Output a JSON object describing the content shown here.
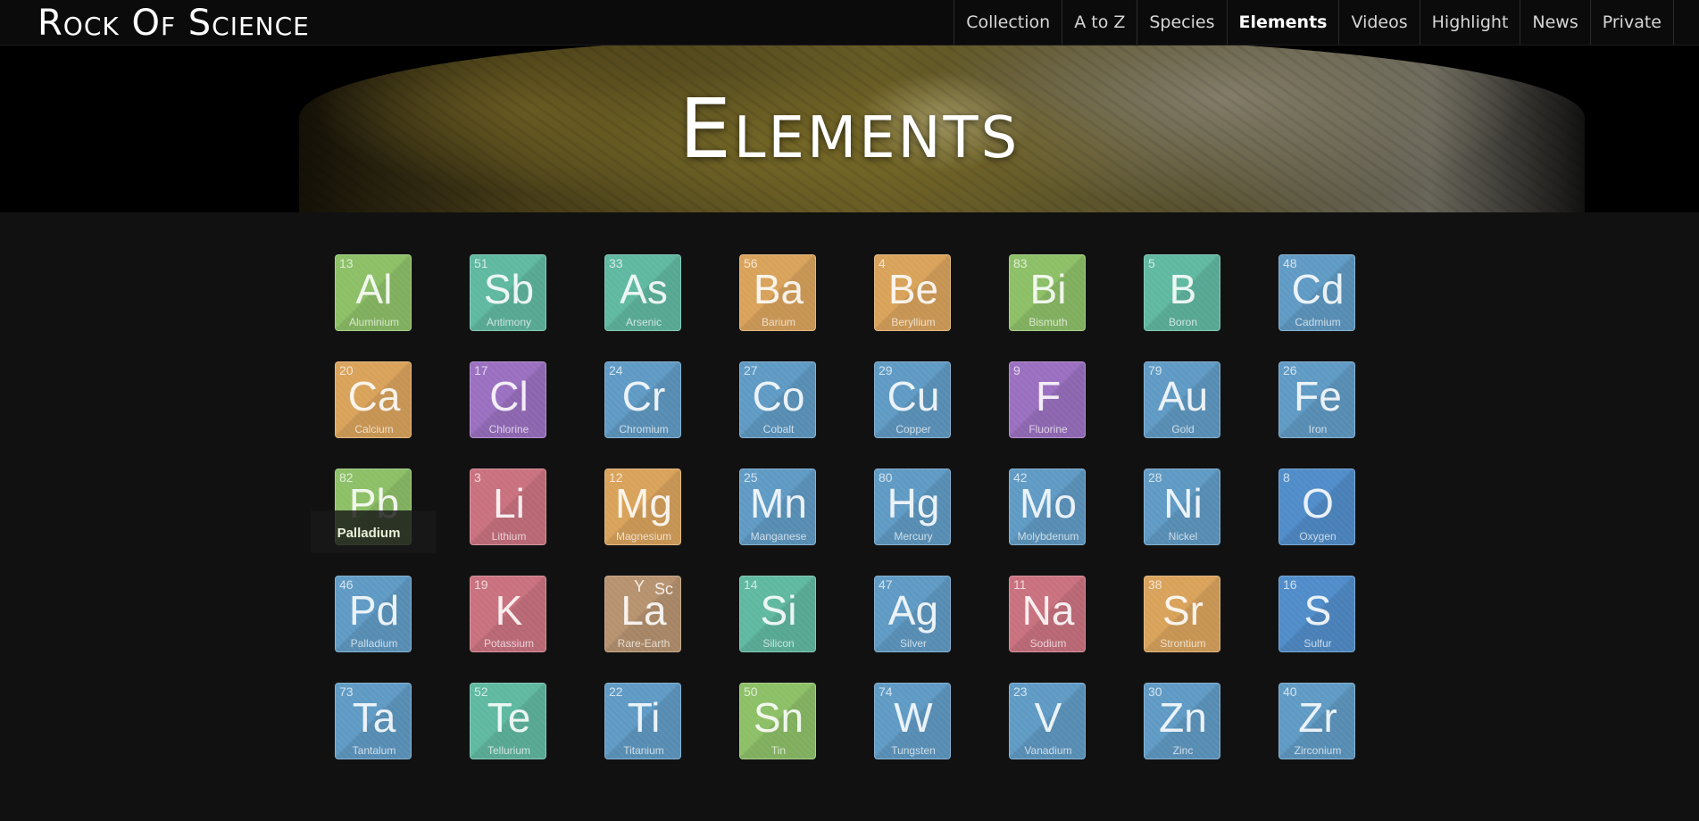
{
  "header": {
    "brand": "Rock Of Science",
    "nav": [
      {
        "label": "Collection",
        "active": false
      },
      {
        "label": "A to Z",
        "active": false
      },
      {
        "label": "Species",
        "active": false
      },
      {
        "label": "Elements",
        "active": true
      },
      {
        "label": "Videos",
        "active": false
      },
      {
        "label": "Highlight",
        "active": false
      },
      {
        "label": "News",
        "active": false
      },
      {
        "label": "Private",
        "active": false
      }
    ]
  },
  "hero": {
    "title": "Elements"
  },
  "tooltip": {
    "text": "Palladium"
  },
  "colors": {
    "green": "#8cbf66",
    "teal": "#5fb8a0",
    "orange": "#d9a25a",
    "blue": "#5f9ac4",
    "purple": "#9a6fc0",
    "pink": "#c9717e",
    "brown": "#b6926f",
    "dblue": "#4f8cc9"
  },
  "elements": [
    {
      "num": "13",
      "sym": "Al",
      "name": "Aluminium",
      "color": "green"
    },
    {
      "num": "51",
      "sym": "Sb",
      "name": "Antimony",
      "color": "teal"
    },
    {
      "num": "33",
      "sym": "As",
      "name": "Arsenic",
      "color": "teal"
    },
    {
      "num": "56",
      "sym": "Ba",
      "name": "Barium",
      "color": "orange"
    },
    {
      "num": "4",
      "sym": "Be",
      "name": "Beryllium",
      "color": "orange"
    },
    {
      "num": "83",
      "sym": "Bi",
      "name": "Bismuth",
      "color": "green"
    },
    {
      "num": "5",
      "sym": "B",
      "name": "Boron",
      "color": "teal"
    },
    {
      "num": "48",
      "sym": "Cd",
      "name": "Cadmium",
      "color": "blue"
    },
    {
      "num": "20",
      "sym": "Ca",
      "name": "Calcium",
      "color": "orange"
    },
    {
      "num": "17",
      "sym": "Cl",
      "name": "Chlorine",
      "color": "purple"
    },
    {
      "num": "24",
      "sym": "Cr",
      "name": "Chromium",
      "color": "blue"
    },
    {
      "num": "27",
      "sym": "Co",
      "name": "Cobalt",
      "color": "blue"
    },
    {
      "num": "29",
      "sym": "Cu",
      "name": "Copper",
      "color": "blue"
    },
    {
      "num": "9",
      "sym": "F",
      "name": "Fluorine",
      "color": "purple"
    },
    {
      "num": "79",
      "sym": "Au",
      "name": "Gold",
      "color": "blue"
    },
    {
      "num": "26",
      "sym": "Fe",
      "name": "Iron",
      "color": "blue"
    },
    {
      "num": "82",
      "sym": "Pb",
      "name": "",
      "color": "green"
    },
    {
      "num": "3",
      "sym": "Li",
      "name": "Lithium",
      "color": "pink"
    },
    {
      "num": "12",
      "sym": "Mg",
      "name": "Magnesium",
      "color": "orange"
    },
    {
      "num": "25",
      "sym": "Mn",
      "name": "Manganese",
      "color": "blue"
    },
    {
      "num": "80",
      "sym": "Hg",
      "name": "Mercury",
      "color": "blue"
    },
    {
      "num": "42",
      "sym": "Mo",
      "name": "Molybdenum",
      "color": "blue"
    },
    {
      "num": "28",
      "sym": "Ni",
      "name": "Nickel",
      "color": "blue"
    },
    {
      "num": "8",
      "sym": "O",
      "name": "Oxygen",
      "color": "dblue"
    },
    {
      "num": "46",
      "sym": "Pd",
      "name": "Palladium",
      "color": "blue"
    },
    {
      "num": "19",
      "sym": "K",
      "name": "Potassium",
      "color": "pink"
    },
    {
      "num": "",
      "sym": "La",
      "name": "Rare-Earth",
      "color": "brown",
      "extra1": "Y",
      "extra2": "Sc"
    },
    {
      "num": "14",
      "sym": "Si",
      "name": "Silicon",
      "color": "teal"
    },
    {
      "num": "47",
      "sym": "Ag",
      "name": "Silver",
      "color": "blue"
    },
    {
      "num": "11",
      "sym": "Na",
      "name": "Sodium",
      "color": "pink"
    },
    {
      "num": "38",
      "sym": "Sr",
      "name": "Strontium",
      "color": "orange"
    },
    {
      "num": "16",
      "sym": "S",
      "name": "Sulfur",
      "color": "dblue"
    },
    {
      "num": "73",
      "sym": "Ta",
      "name": "Tantalum",
      "color": "blue"
    },
    {
      "num": "52",
      "sym": "Te",
      "name": "Tellurium",
      "color": "teal"
    },
    {
      "num": "22",
      "sym": "Ti",
      "name": "Titanium",
      "color": "blue"
    },
    {
      "num": "50",
      "sym": "Sn",
      "name": "Tin",
      "color": "green"
    },
    {
      "num": "74",
      "sym": "W",
      "name": "Tungsten",
      "color": "blue"
    },
    {
      "num": "23",
      "sym": "V",
      "name": "Vanadium",
      "color": "blue"
    },
    {
      "num": "30",
      "sym": "Zn",
      "name": "Zinc",
      "color": "blue"
    },
    {
      "num": "40",
      "sym": "Zr",
      "name": "Zirconium",
      "color": "blue"
    }
  ]
}
